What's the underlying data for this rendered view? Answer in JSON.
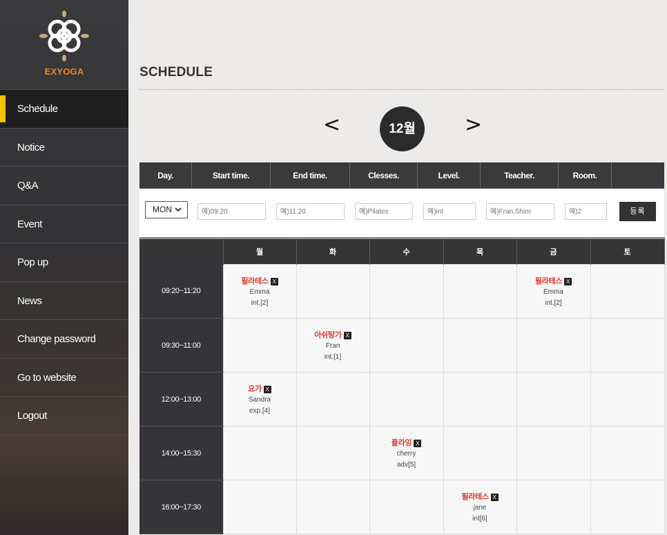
{
  "sidebar": {
    "brand": "EXYOGA",
    "items": [
      {
        "label": "Schedule",
        "active": true
      },
      {
        "label": "Notice"
      },
      {
        "label": "Q&A"
      },
      {
        "label": "Event"
      },
      {
        "label": "Pop up"
      },
      {
        "label": "News"
      },
      {
        "label": "Change password"
      },
      {
        "label": "Go to website"
      },
      {
        "label": "Logout"
      }
    ],
    "accent_color": "#f5c400",
    "brand_color": "#e8802c"
  },
  "header": {
    "title": "SCHEDULE"
  },
  "month_nav": {
    "prev": "<",
    "month": "12월",
    "next": ">"
  },
  "form": {
    "headers": [
      "Day.",
      "Start time.",
      "End time.",
      "Clesses.",
      "Level.",
      "Teacher.",
      "Room.",
      ""
    ],
    "day_value": "MON",
    "placeholders": {
      "start": "예)09:20",
      "end": "예)11:20",
      "classes": "예)Pilates",
      "level": "예)int",
      "teacher": "예)Fran.Shim",
      "room": "예)2"
    },
    "submit_label": "등록"
  },
  "schedule": {
    "days": [
      "월",
      "화",
      "수",
      "목",
      "금",
      "토"
    ],
    "close_label": "X",
    "rows": [
      {
        "time": "09:20~11:20",
        "cells": [
          {
            "name": "필라테스",
            "teacher": "Emma",
            "level": "int.[2]"
          },
          null,
          null,
          null,
          {
            "name": "필라테스",
            "teacher": "Emma",
            "level": "int.[2]"
          },
          null
        ]
      },
      {
        "time": "09:30~11:00",
        "cells": [
          null,
          {
            "name": "아쉬탕가",
            "teacher": "Fran",
            "level": "int.[1]"
          },
          null,
          null,
          null,
          null
        ]
      },
      {
        "time": "12:00~13:00",
        "cells": [
          {
            "name": "요가",
            "teacher": "Sandra",
            "level": "exp.[4]"
          },
          null,
          null,
          null,
          null,
          null
        ]
      },
      {
        "time": "14:00~15:30",
        "cells": [
          null,
          null,
          {
            "name": "플라잉",
            "teacher": "cherry",
            "level": "adv[5]"
          },
          null,
          null,
          null
        ]
      },
      {
        "time": "16:00~17:30",
        "cells": [
          null,
          null,
          null,
          {
            "name": "필라테스",
            "teacher": "jane",
            "level": "int[6]"
          },
          null,
          null
        ]
      }
    ]
  }
}
